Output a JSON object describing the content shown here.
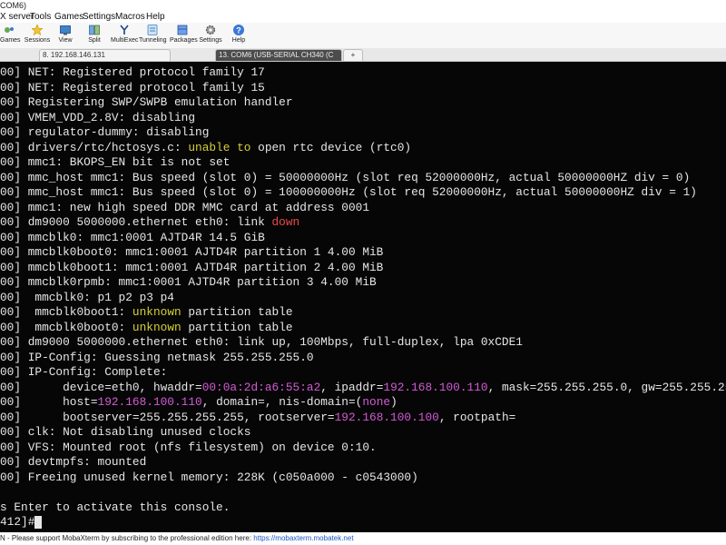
{
  "window": {
    "title": "COM6)"
  },
  "menu": [
    "X server",
    "Tools",
    "Games",
    "Settings",
    "Macros",
    "Help"
  ],
  "toolbar": [
    {
      "label": "Games",
      "icon": "games-icon"
    },
    {
      "label": "Sessions",
      "icon": "sessions-star-icon"
    },
    {
      "label": "View",
      "icon": "view-icon"
    },
    {
      "label": "Split",
      "icon": "split-icon"
    },
    {
      "label": "MultiExec",
      "icon": "multiexec-icon"
    },
    {
      "label": "Tunneling",
      "icon": "tunneling-icon"
    },
    {
      "label": "Packages",
      "icon": "packages-icon"
    },
    {
      "label": "Settings",
      "icon": "settings-gear-icon"
    },
    {
      "label": "Help",
      "icon": "help-icon"
    }
  ],
  "tabs": [
    {
      "label": "8. 192.168.146.131",
      "active": false
    },
    {
      "label": "13. COM6 (USB-SERIAL CH340 (C",
      "active": true
    },
    {
      "label": "+",
      "active": false
    }
  ],
  "terminal": {
    "colors": {
      "text": "#e6e6e6",
      "yellow": "#d6cf3a",
      "red": "#e84a4a",
      "magenta": "#d35ad6",
      "background": "#060606"
    },
    "lines": [
      [
        [
          "00] NET: Registered protocol family 17",
          ""
        ]
      ],
      [
        [
          "00] NET: Registered protocol family 15",
          ""
        ]
      ],
      [
        [
          "00] Registering SWP/SWPB emulation handler",
          ""
        ]
      ],
      [
        [
          "00] VMEM_VDD_2.8V: disabling",
          ""
        ]
      ],
      [
        [
          "00] regulator-dummy: disabling",
          ""
        ]
      ],
      [
        [
          "00] drivers/rtc/hctosys.c: ",
          ""
        ],
        [
          "unable to",
          "y"
        ],
        [
          " open rtc device (rtc0)",
          ""
        ]
      ],
      [
        [
          "00] mmc1: BKOPS_EN bit is not set",
          ""
        ]
      ],
      [
        [
          "00] mmc_host mmc1: Bus speed (slot 0) = 50000000Hz (slot req 52000000Hz, actual 50000000HZ div = 0)",
          ""
        ]
      ],
      [
        [
          "00] mmc_host mmc1: Bus speed (slot 0) = 100000000Hz (slot req 52000000Hz, actual 50000000HZ div = 1)",
          ""
        ]
      ],
      [
        [
          "00] mmc1: new high speed DDR MMC card at address 0001",
          ""
        ]
      ],
      [
        [
          "00] dm9000 5000000.ethernet eth0: link ",
          ""
        ],
        [
          "down",
          "r"
        ]
      ],
      [
        [
          "00] mmcblk0: mmc1:0001 AJTD4R 14.5 GiB",
          ""
        ]
      ],
      [
        [
          "00] mmcblk0boot0: mmc1:0001 AJTD4R partition 1 4.00 MiB",
          ""
        ]
      ],
      [
        [
          "00] mmcblk0boot1: mmc1:0001 AJTD4R partition 2 4.00 MiB",
          ""
        ]
      ],
      [
        [
          "00] mmcblk0rpmb: mmc1:0001 AJTD4R partition 3 4.00 MiB",
          ""
        ]
      ],
      [
        [
          "00]  mmcblk0: p1 p2 p3 p4",
          ""
        ]
      ],
      [
        [
          "00]  mmcblk0boot1: ",
          ""
        ],
        [
          "unknown",
          "y"
        ],
        [
          " partition table",
          ""
        ]
      ],
      [
        [
          "00]  mmcblk0boot0: ",
          ""
        ],
        [
          "unknown",
          "y"
        ],
        [
          " partition table",
          ""
        ]
      ],
      [
        [
          "00] dm9000 5000000.ethernet eth0: link up, 100Mbps, full-duplex, lpa 0xCDE1",
          ""
        ]
      ],
      [
        [
          "00] IP-Config: Guessing netmask 255.255.255.0",
          ""
        ]
      ],
      [
        [
          "00] IP-Config: Complete:",
          ""
        ]
      ],
      [
        [
          "00]      device=eth0, hwaddr=",
          ""
        ],
        [
          "00:0a:2d:a6:55:a2",
          "m"
        ],
        [
          ", ipaddr=",
          ""
        ],
        [
          "192.168.100.110",
          "m"
        ],
        [
          ", mask=255.255.255.0, gw=255.255.255.",
          ""
        ]
      ],
      [
        [
          "00]      host=",
          ""
        ],
        [
          "192.168.100.110",
          "m"
        ],
        [
          ", domain=, nis-domain=(",
          ""
        ],
        [
          "none",
          "m"
        ],
        [
          ")",
          ""
        ]
      ],
      [
        [
          "00]      bootserver=255.255.255.255, rootserver=",
          ""
        ],
        [
          "192.168.100.100",
          "m"
        ],
        [
          ", rootpath=",
          ""
        ]
      ],
      [
        [
          "00] clk: Not disabling unused clocks",
          ""
        ]
      ],
      [
        [
          "00] VFS: Mounted root (nfs filesystem) on device 0:10.",
          ""
        ]
      ],
      [
        [
          "00] devtmpfs: mounted",
          ""
        ]
      ],
      [
        [
          "00] Freeing unused kernel memory: 228K (c050a000 - c0543000)",
          ""
        ]
      ],
      [
        [
          "",
          ""
        ]
      ],
      [
        [
          "s Enter to activate this console.",
          ""
        ]
      ],
      [
        [
          "412]#",
          ""
        ]
      ]
    ]
  },
  "status": {
    "text": "N  -  Please support MobaXterm by subscribing to the professional edition here: ",
    "link": "https://mobaxterm.mobatek.net"
  }
}
